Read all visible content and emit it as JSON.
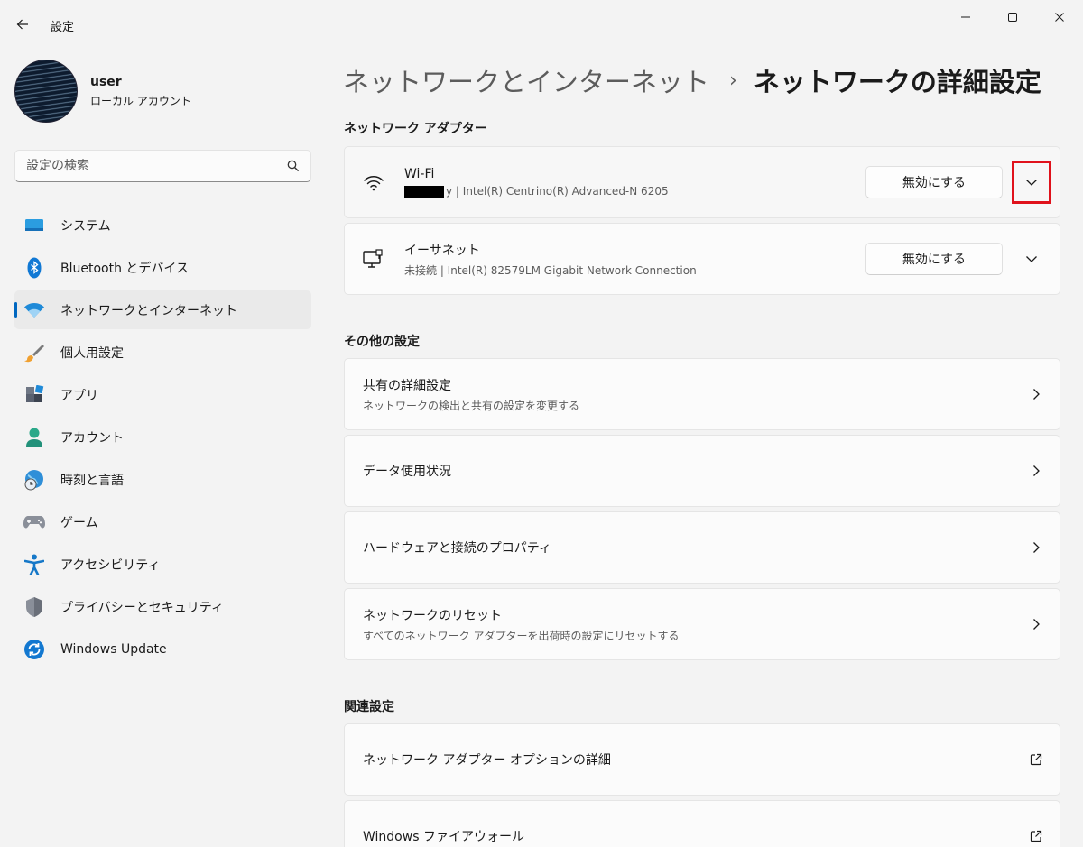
{
  "window": {
    "title": "設定"
  },
  "profile": {
    "name": "user",
    "account_type": "ローカル アカウント"
  },
  "search": {
    "placeholder": "設定の検索"
  },
  "sidebar": {
    "items": [
      {
        "label": "システム",
        "icon": "system-icon"
      },
      {
        "label": "Bluetooth とデバイス",
        "icon": "bluetooth-icon"
      },
      {
        "label": "ネットワークとインターネット",
        "icon": "network-icon",
        "active": true
      },
      {
        "label": "個人用設定",
        "icon": "brush-icon"
      },
      {
        "label": "アプリ",
        "icon": "apps-icon"
      },
      {
        "label": "アカウント",
        "icon": "account-icon"
      },
      {
        "label": "時刻と言語",
        "icon": "globe-clock-icon"
      },
      {
        "label": "ゲーム",
        "icon": "gamepad-icon"
      },
      {
        "label": "アクセシビリティ",
        "icon": "accessibility-icon"
      },
      {
        "label": "プライバシーとセキュリティ",
        "icon": "shield-icon"
      },
      {
        "label": "Windows Update",
        "icon": "update-icon"
      }
    ]
  },
  "breadcrumb": {
    "parent": "ネットワークとインターネット",
    "separator": "›",
    "current": "ネットワークの詳細設定"
  },
  "adapters_section": {
    "title": "ネットワーク アダプター",
    "items": [
      {
        "name": "Wi-Fi",
        "desc_suffix": "y | Intel(R) Centrino(R) Advanced-N 6205",
        "button": "無効にする",
        "icon": "wifi-icon"
      },
      {
        "name": "イーサネット",
        "desc": "未接続 | Intel(R) 82579LM Gigabit Network Connection",
        "button": "無効にする",
        "icon": "ethernet-icon"
      }
    ]
  },
  "other_section": {
    "title": "その他の設定",
    "items": [
      {
        "title": "共有の詳細設定",
        "subtitle": "ネットワークの検出と共有の設定を変更する"
      },
      {
        "title": "データ使用状況"
      },
      {
        "title": "ハードウェアと接続のプロパティ"
      },
      {
        "title": "ネットワークのリセット",
        "subtitle": "すべてのネットワーク アダプターを出荷時の設定にリセットする"
      }
    ]
  },
  "related_section": {
    "title": "関連設定",
    "items": [
      {
        "title": "ネットワーク アダプター オプションの詳細"
      },
      {
        "title": "Windows ファイアウォール"
      }
    ]
  },
  "colors": {
    "accent": "#0067c0",
    "highlight_box": "#e0121c",
    "background": "#f3f3f3",
    "card": "#fbfbfb"
  }
}
